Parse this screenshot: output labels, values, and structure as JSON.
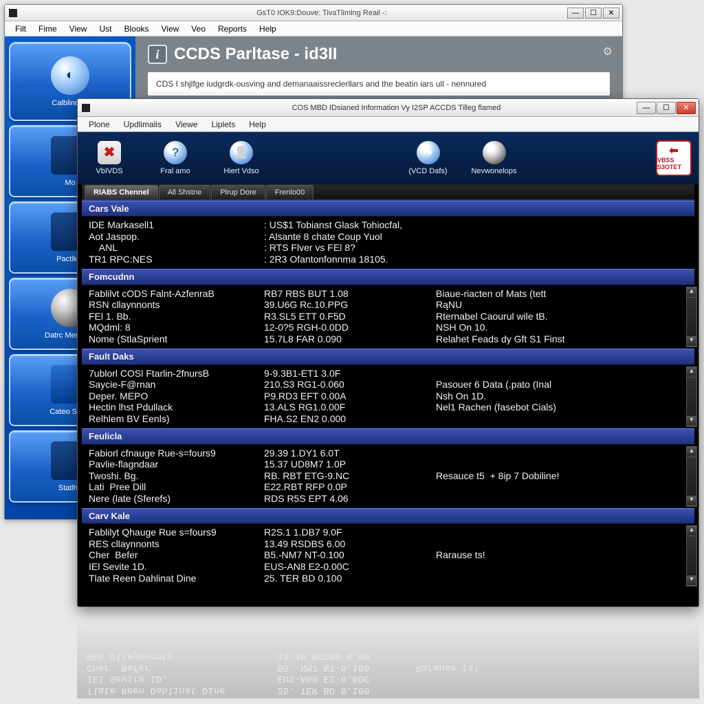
{
  "bg_window": {
    "title": "GsT0 IOK9:Douve: TivaTlimlng Reail -:",
    "menubar": [
      "Filt",
      "Fime",
      "View",
      "Ust",
      "Blooks",
      "View",
      "Veo",
      "Reports",
      "Help"
    ],
    "panel_title": "CCDS Parltase - id3II",
    "panel_desc": "CDS I shjlfge iudgrdk-ousving and demanaaissreclerllars and the beatin iars ull - nennured",
    "sidebar": [
      {
        "label": "Calblinol R"
      },
      {
        "label": "Mo"
      },
      {
        "label": "Pactlkro"
      },
      {
        "label": "Datrc Menoling"
      },
      {
        "label": "Cateo Siqsk"
      },
      {
        "label": "Statlhe"
      }
    ]
  },
  "fg_window": {
    "title": "COS MBD IDsianed Information Vy I2SP ACCDS Tilleg flamed",
    "menubar": [
      "Plone",
      "Updlimalis",
      "Viewe",
      "Liplets",
      "Help"
    ],
    "toolbar": [
      {
        "name": "vbivds",
        "label": "VbIVDS"
      },
      {
        "name": "fral-amo",
        "label": "Fral amo"
      },
      {
        "name": "hiert-vdso",
        "label": "Hiert Vdso"
      },
      {
        "name": "vcd-dafs",
        "label": "(VCD Dafs)"
      },
      {
        "name": "nevwonelops",
        "label": "Nevwonelops"
      }
    ],
    "stop_label": "VBSS S3OTET",
    "tabs": [
      "RIABS Chennel",
      "All Shstne",
      "Plrup Dore",
      "Frenlo00"
    ],
    "sections": [
      {
        "title": "Cars Vale",
        "rows": [
          {
            "c1": "IDE Markasell1",
            "c2": ": US$1 Tobianst Glask Tohiocfal,",
            "c3": ""
          },
          {
            "c1": "Aot Jaspop.",
            "c2": ": Alsante 8 chate Coup Yuol",
            "c3": ""
          },
          {
            "c1": "    ANL",
            "c2": ": RTS Flver vs FEl 8?",
            "c3": ""
          },
          {
            "c1": "TR1 RPC:NES",
            "c2": ": 2R3 Ofantonfonnma 18105.",
            "c3": ""
          }
        ]
      },
      {
        "title": "Fomcudnn",
        "rows": [
          {
            "c1": "Fablilvt cODS Falnt-AzfenraB",
            "c2": "RB7 RBS BUT 1.08",
            "c3": "Biaue-riacten of Mats (tett"
          },
          {
            "c1": "RSN cllaynnonts",
            "c2": "39.U6G Rc.10.PPG",
            "c3": "RąNU"
          },
          {
            "c1": "FEl 1. Bb.",
            "c2": "R3.SL5 ETT 0.F5D",
            "c3": "Rternabel Caourul wile tB."
          },
          {
            "c1": "MQdml: 8",
            "c2": "12-0?5 RGH-0.0DD",
            "c3": "NSH On 10."
          },
          {
            "c1": "Nome (StlaSprient",
            "c2": "15.7L8 FAR 0.090",
            "c3": "Relahet Feads dy Gft S1 Finst"
          }
        ]
      },
      {
        "title": "Fault Daks",
        "rows": [
          {
            "c1": "7ublorl COSl Ftarlin-2fnursB",
            "c2": "9-9.3B1-ET1 3.0F",
            "c3": ""
          },
          {
            "c1": "Saycie-F@rnan",
            "c2": "210.S3 RG1-0.060",
            "c3": "Pasouer 6 Data (.pato (Inal"
          },
          {
            "c1": "Deper. MEPO",
            "c2": "P9.RD3 EFT 0.00A",
            "c3": "Nsh On 1D."
          },
          {
            "c1": "Hectin lhst Pdullack",
            "c2": "13.ALS RG1.0.00F",
            "c3": "Nel1 Rachen (fasebot Cials)"
          },
          {
            "c1": "Relhlem BV Eenls)",
            "c2": "FHA.S2 EN2 0.000",
            "c3": ""
          }
        ]
      },
      {
        "title": "Feulicla",
        "rows": [
          {
            "c1": "Fabiorl cfnauge Rue-s=fours9",
            "c2": "29.39 1.DY1 6.0T",
            "c3": ""
          },
          {
            "c1": "Pavlie-flagndaar",
            "c2": "15.37 UD8M7 1.0P",
            "c3": ""
          },
          {
            "c1": "Twoshi. Bg.",
            "c2": "RB. RBT ETG-9.NC",
            "c3": "Resauce t5  + 8ip 7 Dobiline!"
          },
          {
            "c1": "Lati  Pree Dill",
            "c2": "E22.RBT RFP 0.0P",
            "c3": ""
          },
          {
            "c1": "Nere (late (Sferefs)",
            "c2": "RDS R5S EPT 4.06",
            "c3": ""
          }
        ]
      },
      {
        "title": "Carv Kale",
        "rows": [
          {
            "c1": "Fablilyt Qhauge Rue s=fours9",
            "c2": "R2S.1 1.DB7 9.0F",
            "c3": ""
          },
          {
            "c1": "RES cllaynnonts",
            "c2": "13.49 RSDBS 6.00",
            "c3": ""
          },
          {
            "c1": "Cher  Befer",
            "c2": "B5.-NM7 NT-0.100",
            "c3": "Rarause ts!"
          },
          {
            "c1": "IEl Sevite 1D.",
            "c2": "EUS-AN8 E2-0.00C",
            "c3": ""
          },
          {
            "c1": "Tlate Reen Dahlinat Dine",
            "c2": "25. TER BD 0.100",
            "c3": ""
          }
        ]
      }
    ]
  }
}
